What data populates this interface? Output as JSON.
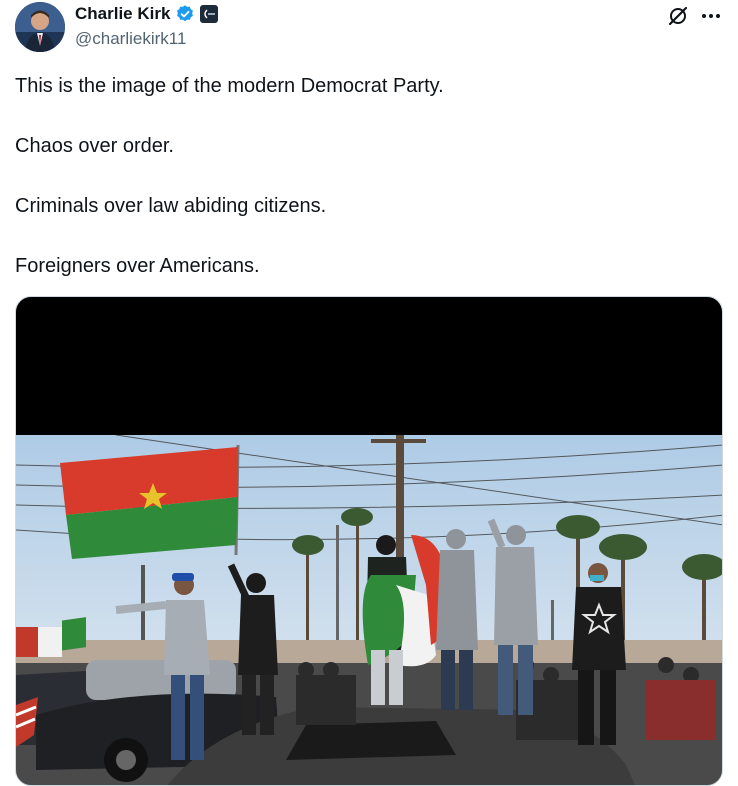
{
  "author": {
    "display_name": "Charlie Kirk",
    "handle": "@charliekirk11",
    "verified_icon": "verified-badge-icon",
    "affiliation_icon": "affiliation-badge-icon"
  },
  "actions": {
    "grok_icon": "grok-icon",
    "more_icon": "more-options-icon"
  },
  "tweet": {
    "lines": [
      "This is the image of the modern Democrat Party.",
      "Chaos over order.",
      "Criminals over law abiding citizens.",
      "Foreigners over Americans."
    ]
  },
  "colors": {
    "text": "#0f1419",
    "secondary": "#536471",
    "verified": "#1d9bf0"
  }
}
